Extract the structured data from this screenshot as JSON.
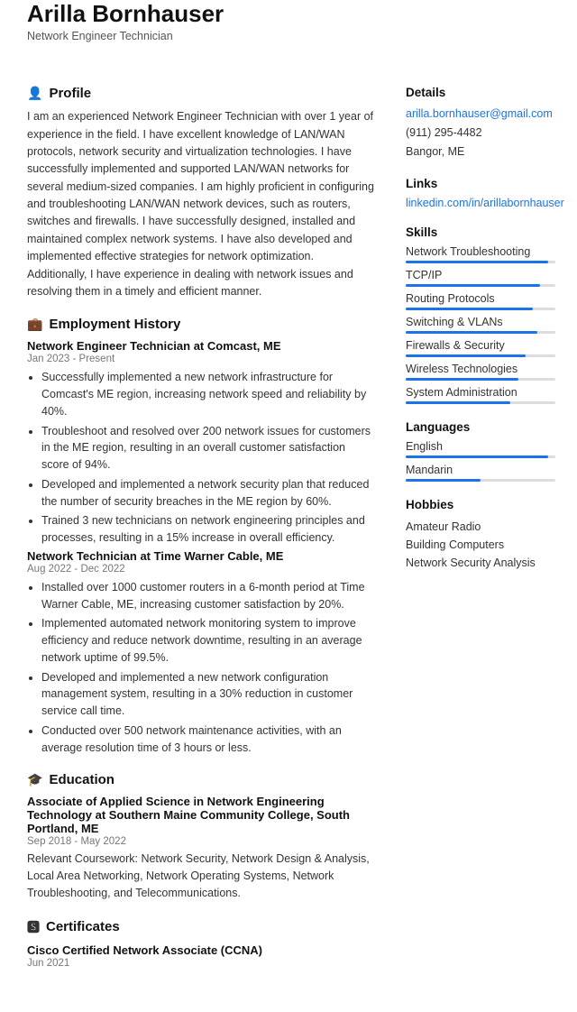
{
  "header": {
    "name": "Arilla Bornhauser",
    "title": "Network Engineer Technician"
  },
  "profile": {
    "section_title": "Profile",
    "text": "I am an experienced Network Engineer Technician with over 1 year of experience in the field. I have excellent knowledge of LAN/WAN protocols, network security and virtualization technologies. I have successfully implemented and supported LAN/WAN networks for several medium-sized companies. I am highly proficient in configuring and troubleshooting LAN/WAN network devices, such as routers, switches and firewalls. I have successfully designed, installed and maintained complex network systems. I have also developed and implemented effective strategies for network optimization. Additionally, I have experience in dealing with network issues and resolving them in a timely and efficient manner."
  },
  "employment": {
    "section_title": "Employment History",
    "jobs": [
      {
        "title": "Network Engineer Technician at Comcast, ME",
        "date": "Jan 2023 - Present",
        "bullets": [
          "Successfully implemented a new network infrastructure for Comcast's ME region, increasing network speed and reliability by 40%.",
          "Troubleshoot and resolved over 200 network issues for customers in the ME region, resulting in an overall customer satisfaction score of 94%.",
          "Developed and implemented a network security plan that reduced the number of security breaches in the ME region by 60%.",
          "Trained 3 new technicians on network engineering principles and processes, resulting in a 15% increase in overall efficiency."
        ]
      },
      {
        "title": "Network Technician at Time Warner Cable, ME",
        "date": "Aug 2022 - Dec 2022",
        "bullets": [
          "Installed over 1000 customer routers in a 6-month period at Time Warner Cable, ME, increasing customer satisfaction by 20%.",
          "Implemented automated network monitoring system to improve efficiency and reduce network downtime, resulting in an average network uptime of 99.5%.",
          "Developed and implemented a new network configuration management system, resulting in a 30% reduction in customer service call time.",
          "Conducted over 500 network maintenance activities, with an average resolution time of 3 hours or less."
        ]
      }
    ]
  },
  "education": {
    "section_title": "Education",
    "items": [
      {
        "title": "Associate of Applied Science in Network Engineering Technology at Southern Maine Community College, South Portland, ME",
        "date": "Sep 2018 - May 2022",
        "text": "Relevant Coursework: Network Security, Network Design & Analysis, Local Area Networking, Network Operating Systems, Network Troubleshooting, and Telecommunications."
      }
    ]
  },
  "certificates": {
    "section_title": "Certificates",
    "items": [
      {
        "title": "Cisco Certified Network Associate (CCNA)",
        "date": "Jun 2021"
      }
    ]
  },
  "details": {
    "section_title": "Details",
    "email": "arilla.bornhauser@gmail.com",
    "phone": "(911) 295-4482",
    "location": "Bangor, ME"
  },
  "links": {
    "section_title": "Links",
    "linkedin": "linkedin.com/in/arillabornhauser"
  },
  "skills": {
    "section_title": "Skills",
    "items": [
      {
        "label": "Network Troubleshooting",
        "fill": 95
      },
      {
        "label": "TCP/IP",
        "fill": 90
      },
      {
        "label": "Routing Protocols",
        "fill": 85
      },
      {
        "label": "Switching & VLANs",
        "fill": 88
      },
      {
        "label": "Firewalls & Security",
        "fill": 80
      },
      {
        "label": "Wireless Technologies",
        "fill": 75
      },
      {
        "label": "System Administration",
        "fill": 70
      }
    ]
  },
  "languages": {
    "section_title": "Languages",
    "items": [
      {
        "label": "English",
        "fill": 95
      },
      {
        "label": "Mandarin",
        "fill": 50
      }
    ]
  },
  "hobbies": {
    "section_title": "Hobbies",
    "items": [
      "Amateur Radio",
      "Building Computers",
      "Network Security Analysis"
    ]
  }
}
